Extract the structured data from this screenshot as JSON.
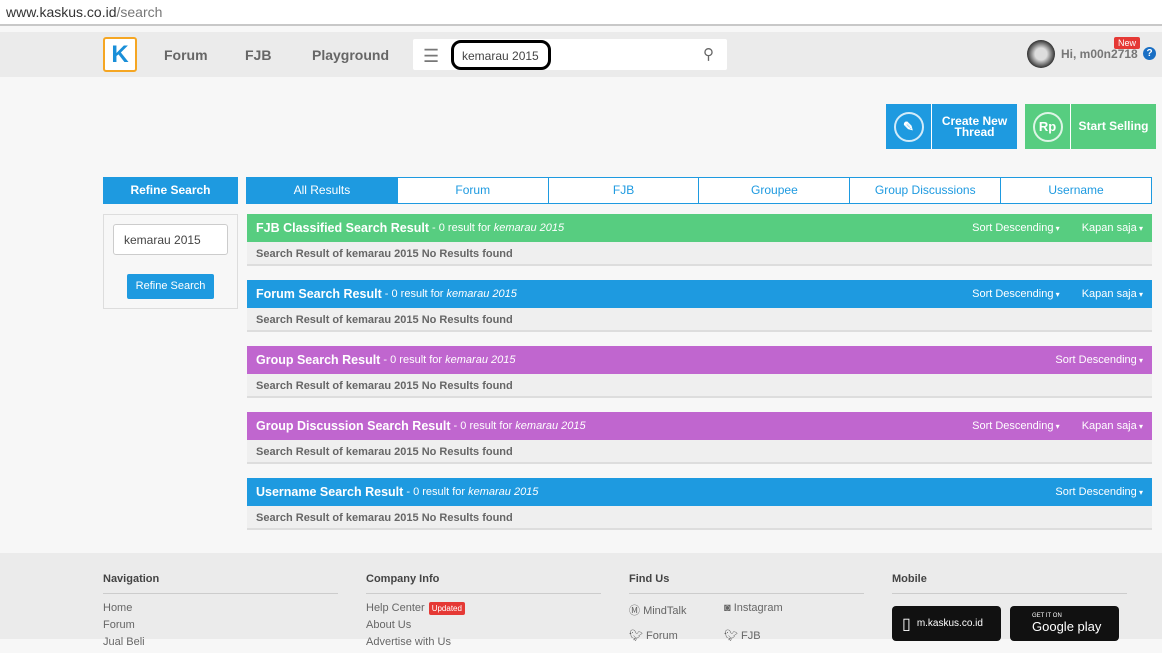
{
  "browser": {
    "url_host": "www.kaskus.co.id",
    "url_path": "/search"
  },
  "nav": {
    "logo": "K",
    "links": [
      "Forum",
      "FJB",
      "Playground"
    ],
    "search_value": "kemarau 2015",
    "user": "Hi, m00n2718",
    "new_badge": "New",
    "help": "?"
  },
  "actions": {
    "create_thread": "Create New Thread",
    "start_selling": "Start Selling",
    "rp": "Rp"
  },
  "refine": {
    "header": "Refine Search",
    "input_value": "kemarau 2015",
    "button": "Refine Search"
  },
  "tabs": [
    "All Results",
    "Forum",
    "FJB",
    "Groupee",
    "Group Discussions",
    "Username"
  ],
  "sections": [
    {
      "title": "FJB Classified Search Result",
      "count": " - 0 result for ",
      "query": "kemarau 2015",
      "sort": "Sort Descending",
      "time": "Kapan saja",
      "body": "Search Result of kemarau 2015 No Results found",
      "color": "#57cd80"
    },
    {
      "title": "Forum Search Result",
      "count": " - 0 result for ",
      "query": "kemarau 2015",
      "sort": "Sort Descending",
      "time": "Kapan saja",
      "body": "Search Result of kemarau 2015 No Results found",
      "color": "#1e9ae0"
    },
    {
      "title": "Group Search Result",
      "count": " - 0 result for ",
      "query": "kemarau 2015",
      "sort": "Sort Descending",
      "body": "Search Result of kemarau 2015 No Results found",
      "color": "#c066cf"
    },
    {
      "title": "Group Discussion Search Result",
      "count": " - 0 result for ",
      "query": "kemarau 2015",
      "sort": "Sort Descending",
      "time": "Kapan saja",
      "body": "Search Result of kemarau 2015 No Results found",
      "color": "#c066cf"
    },
    {
      "title": "Username Search Result",
      "count": " - 0 result for ",
      "query": "kemarau 2015",
      "sort": "Sort Descending",
      "body": "Search Result of kemarau 2015 No Results found",
      "color": "#1e9ae0"
    }
  ],
  "footer": {
    "navigation": {
      "title": "Navigation",
      "items": [
        "Home",
        "Forum",
        "Jual Beli"
      ]
    },
    "company": {
      "title": "Company Info",
      "items": [
        "Help Center",
        "About Us",
        "Advertise with Us"
      ],
      "updated": "Updated"
    },
    "find": {
      "title": "Find Us",
      "items": [
        "MindTalk",
        "Instagram",
        "Forum",
        "FJB"
      ]
    },
    "mobile": {
      "title": "Mobile",
      "site": "m.kaskus.co.id",
      "play_small": "GET IT ON",
      "play": "Google play"
    }
  }
}
